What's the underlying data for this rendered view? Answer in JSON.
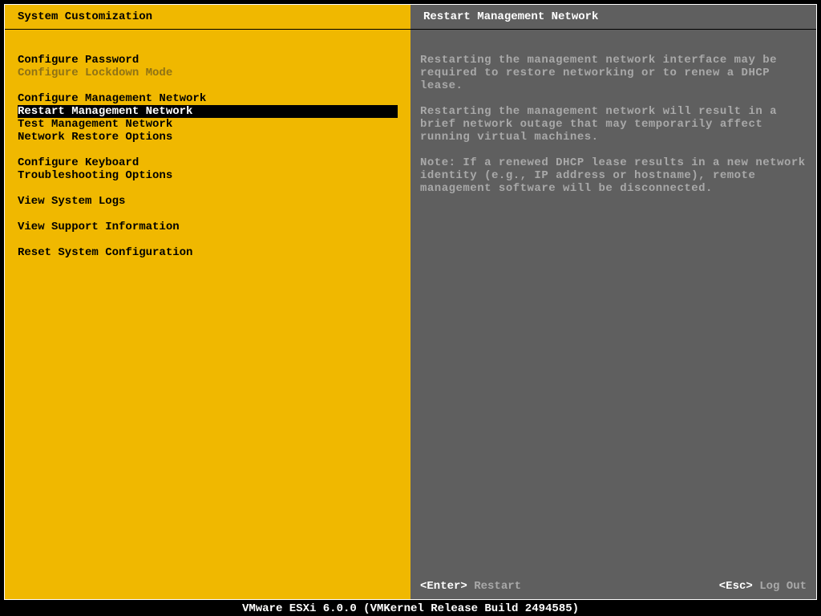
{
  "left": {
    "title": "System Customization",
    "menu": [
      {
        "label": "Configure Password",
        "type": "item"
      },
      {
        "label": "Configure Lockdown Mode",
        "type": "item",
        "disabled": true
      },
      {
        "type": "spacer"
      },
      {
        "label": "Configure Management Network",
        "type": "item"
      },
      {
        "label": "Restart Management Network",
        "type": "item",
        "selected": true
      },
      {
        "label": "Test Management Network",
        "type": "item"
      },
      {
        "label": "Network Restore Options",
        "type": "item"
      },
      {
        "type": "spacer"
      },
      {
        "label": "Configure Keyboard",
        "type": "item"
      },
      {
        "label": "Troubleshooting Options",
        "type": "item"
      },
      {
        "type": "spacer"
      },
      {
        "label": "View System Logs",
        "type": "item"
      },
      {
        "type": "spacer"
      },
      {
        "label": "View Support Information",
        "type": "item"
      },
      {
        "type": "spacer"
      },
      {
        "label": "Reset System Configuration",
        "type": "item"
      }
    ]
  },
  "right": {
    "title": "Restart Management Network",
    "paragraphs": [
      "Restarting the management network interface may be required to restore networking or to renew a DHCP lease.",
      "Restarting the management network will result in a brief network outage that may temporarily affect running virtual machines.",
      "Note: If a renewed DHCP lease results in a new network identity (e.g., IP address or hostname), remote management software will be disconnected."
    ],
    "hints": {
      "enter_key": "<Enter>",
      "enter_action": "Restart",
      "esc_key": "<Esc>",
      "esc_action": "Log Out"
    }
  },
  "status_bar": "VMware ESXi 6.0.0 (VMKernel Release Build 2494585)"
}
